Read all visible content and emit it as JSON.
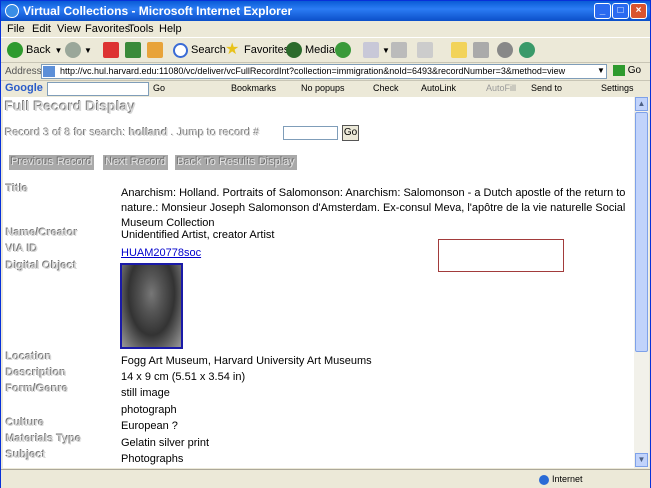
{
  "window": {
    "title": "Virtual Collections - Microsoft Internet Explorer"
  },
  "menu": [
    "File",
    "Edit",
    "View",
    "Favorites",
    "Tools",
    "Help"
  ],
  "toolbar": {
    "back": "Back",
    "search": "Search",
    "favorites": "Favorites",
    "media": "Media"
  },
  "address": {
    "label": "Address",
    "url": "http://vc.hul.harvard.edu:11080/vc/deliver/vcFullRecordInt?collection=immigration&noId=6493&recordNumber=3&method=view",
    "go": "Go"
  },
  "googlebar": {
    "logo": "Google",
    "go": "Go",
    "bookmarks": "Bookmarks",
    "popups": "No popups",
    "check": "Check",
    "autolink": "AutoLink",
    "autofill": "AutoFill",
    "sendto": "Send to",
    "settings": "Settings"
  },
  "page": {
    "title": "Full Record Display",
    "search_prefix": "Record 3 of 8  for search:",
    "search_term": "holland",
    "jump_label": ". Jump to record #",
    "jump_go": "Go",
    "buttons": {
      "previous": "Previous Record",
      "next": "Next Record",
      "back": "Back To Results Display"
    },
    "fields": [
      {
        "label": "Title",
        "value": "Anarchism: Holland. Portraits of Salomonson: Anarchism: Salomonson - a Dutch apostle of the return to nature.: Monsieur Joseph Salomonson d'Amsterdam. Ex-consul Meva, l'apôtre de la vie naturelle Social Museum Collection"
      },
      {
        "label": "Name/Creator",
        "value": "Unidentified Artist,  creator Artist"
      },
      {
        "label": "VIA ID",
        "value": "HUAM20778soc"
      },
      {
        "label": "Digital Object",
        "value": ""
      },
      {
        "label": "Location",
        "value": "Fogg Art Museum, Harvard University Art Museums"
      },
      {
        "label": "Description",
        "value": "14 x 9 cm (5.51 x 3.54 in)"
      },
      {
        "label": "Form/Genre",
        "value": "still image"
      },
      {
        "label": "",
        "value": "photograph"
      },
      {
        "label": "Culture",
        "value": "European ?"
      },
      {
        "label": "Materials Type",
        "value": "Gelatin silver print"
      },
      {
        "label": "Subject",
        "value": "Photographs"
      }
    ]
  },
  "status": {
    "zone": "Internet"
  }
}
